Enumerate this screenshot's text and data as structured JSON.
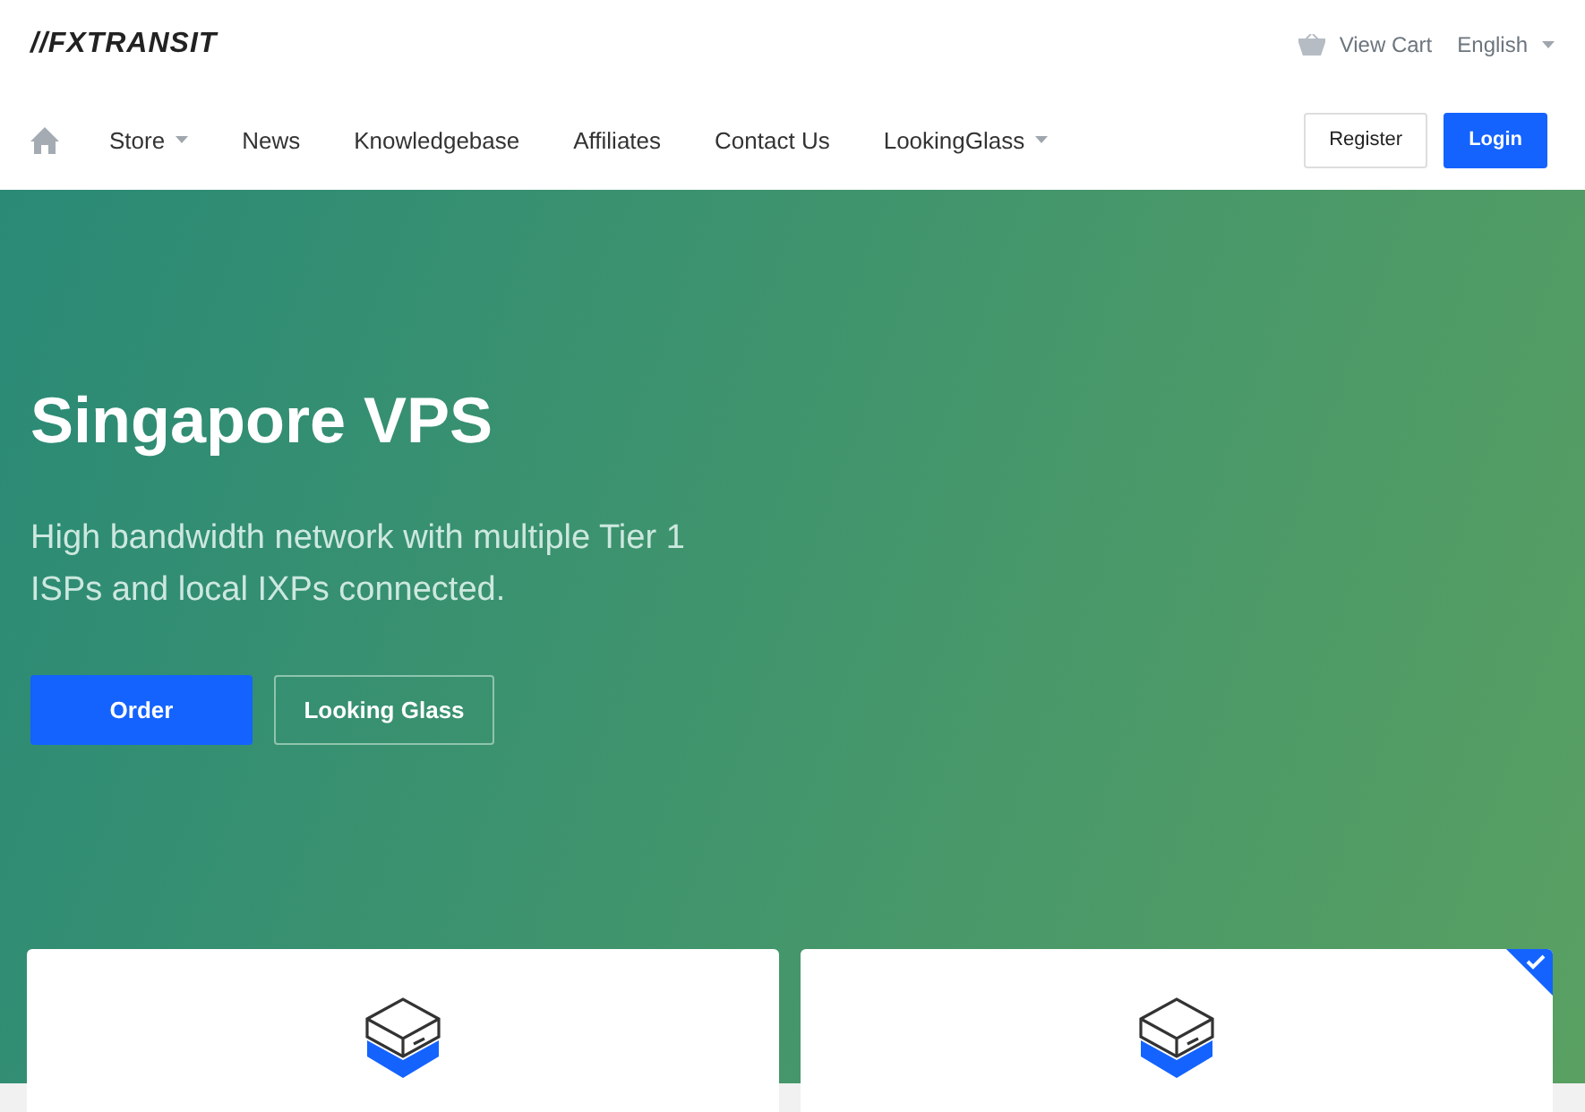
{
  "brand": {
    "logo": "//FXTRANSIT"
  },
  "topbar": {
    "cart": "View Cart",
    "language": "English"
  },
  "nav": {
    "items": [
      {
        "label": "Store",
        "dropdown": true
      },
      {
        "label": "News",
        "dropdown": false
      },
      {
        "label": "Knowledgebase",
        "dropdown": false
      },
      {
        "label": "Affiliates",
        "dropdown": false
      },
      {
        "label": "Contact Us",
        "dropdown": false
      },
      {
        "label": "LookingGlass",
        "dropdown": true
      }
    ],
    "buttons": [
      {
        "label": "Register",
        "kind": "outline"
      },
      {
        "label": "Login",
        "kind": "primary"
      }
    ]
  },
  "hero": {
    "title": "Singapore VPS",
    "subtitle": "High bandwidth network with multiple Tier 1 ISPs and local IXPs connected.",
    "buttons": [
      {
        "label": "Order",
        "kind": "primary"
      },
      {
        "label": "Looking Glass",
        "kind": "outline"
      }
    ]
  },
  "products": [
    {
      "selected": false
    },
    {
      "selected": true
    }
  ]
}
